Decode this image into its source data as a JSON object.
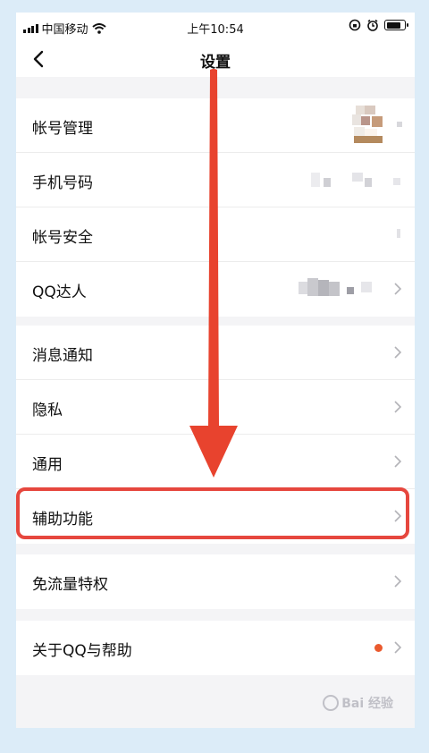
{
  "status_bar": {
    "carrier": "中国移动",
    "time": "上午10:54"
  },
  "nav": {
    "title": "设置"
  },
  "groups": [
    {
      "items": [
        {
          "label": "帐号管理"
        },
        {
          "label": "手机号码"
        },
        {
          "label": "帐号安全"
        },
        {
          "label": "QQ达人"
        }
      ]
    },
    {
      "items": [
        {
          "label": "消息通知"
        },
        {
          "label": "隐私"
        },
        {
          "label": "通用"
        },
        {
          "label": "辅助功能"
        }
      ]
    },
    {
      "items": [
        {
          "label": "免流量特权"
        }
      ]
    },
    {
      "items": [
        {
          "label": "关于QQ与帮助"
        }
      ]
    }
  ],
  "annotation": {
    "highlighted_item": "辅助功能",
    "arrow_color": "#e8432e",
    "box_color": "#e6473e"
  },
  "watermark": {
    "text": "Bai 经验"
  },
  "colors": {
    "background": "#f4f4f6",
    "frame": "#dcecf8",
    "notification_dot": "#ea5a2e"
  }
}
